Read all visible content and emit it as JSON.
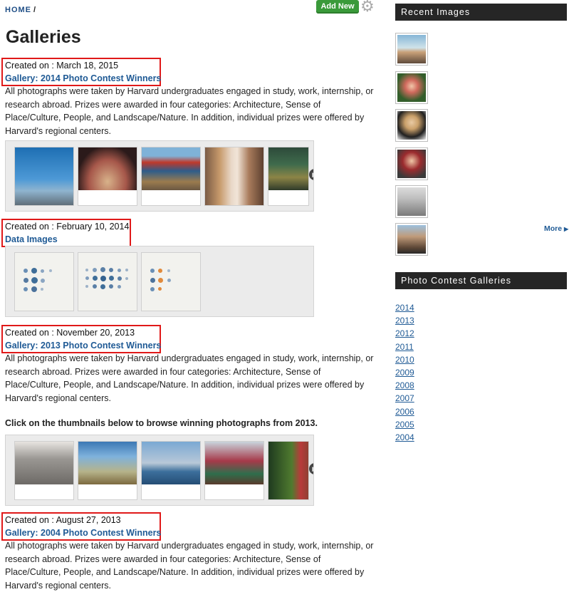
{
  "breadcrumb": {
    "home": "HOME",
    "separator": "/"
  },
  "toolbar": {
    "add_new_label": "Add New",
    "settings_icon": "gear-icon"
  },
  "page_title": "Galleries",
  "entries": [
    {
      "created": "Created on : March 18, 2015",
      "title": "Gallery: 2014 Photo Contest Winners",
      "description": "All photographs were taken by Harvard undergraduates engaged in study, work, internship, or research abroad. Prizes were awarded in four categories: Architecture, Sense of Place/Culture, People, and Landscape/Nature. In addition, individual prizes were offered by Harvard's regional centers."
    },
    {
      "created": "Created on : February 10, 2014",
      "title": "Data Images"
    },
    {
      "created": "Created on : November 20, 2013",
      "title": "Gallery: 2013 Photo Contest Winners",
      "description": "All photographs were taken by Harvard undergraduates engaged in study, work, internship, or research abroad. Prizes were awarded in four categories: Architecture, Sense of Place/Culture, People, and Landscape/Nature. In addition, individual prizes were offered by Harvard's regional centers.",
      "instruction": "Click on the thumbnails below to browse winning photographs from 2013."
    },
    {
      "created": "Created on : August 27, 2013",
      "title": "Gallery: 2004 Photo Contest Winners",
      "description": "All photographs were taken by Harvard undergraduates engaged in study, work, internship, or research abroad. Prizes were awarded in four categories: Architecture, Sense of Place/Culture, People, and Landscape/Nature. In addition, individual prizes were offered by Harvard's regional centers."
    }
  ],
  "sidebar": {
    "recent_images_heading": "Recent Images",
    "more_label": "More",
    "more_icon": "triangle-right-icon",
    "contest_heading": "Photo Contest Galleries",
    "years": [
      "2014",
      "2013",
      "2012",
      "2011",
      "2010",
      "2009",
      "2008",
      "2007",
      "2006",
      "2005",
      "2004"
    ]
  },
  "colors": {
    "accent_link": "#1f5a95",
    "highlight_border": "#e01919",
    "add_new": "#3a9a3a",
    "sidebar_heading_bg": "#262626"
  }
}
